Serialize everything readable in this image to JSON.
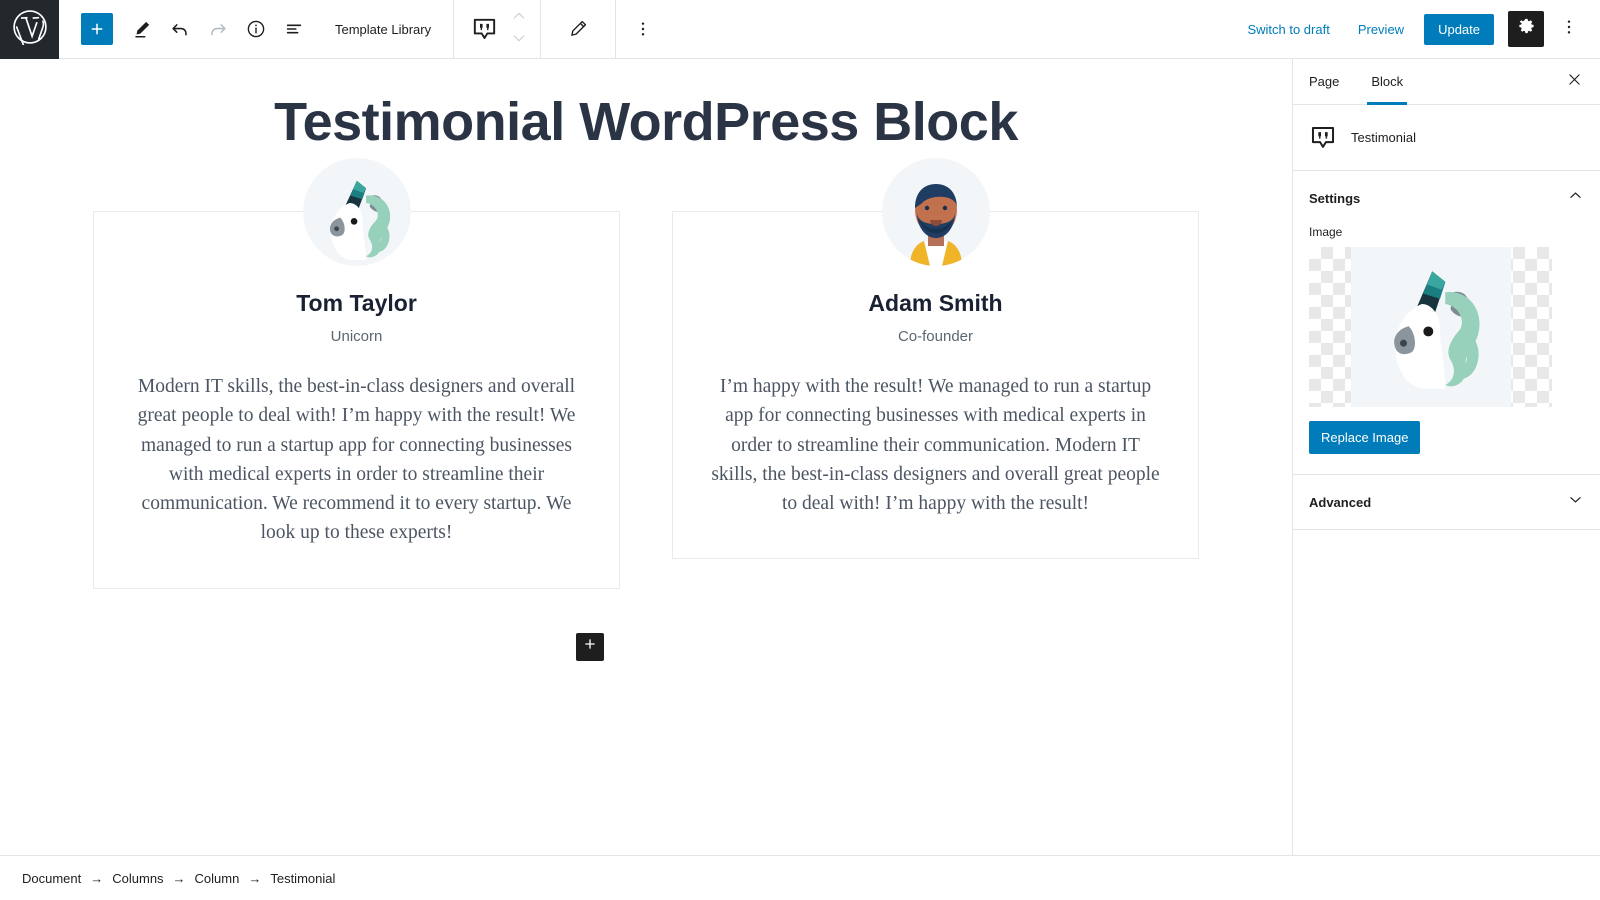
{
  "toolbar": {
    "logo_icon": "wordpress-logo-icon",
    "add_block_label": "+",
    "add_block_icon": "plus-icon",
    "edit_icon": "pencil-edit-icon",
    "undo_icon": "undo-arrow-icon",
    "redo_icon": "redo-arrow-icon",
    "info_icon": "info-circle-icon",
    "list_view_icon": "list-view-icon",
    "template_library_label": "Template Library",
    "block_type_icon": "quote-block-icon",
    "move_up_icon": "chevron-up-icon",
    "move_down_icon": "chevron-down-icon",
    "block_edit_icon": "pencil-icon",
    "block_options_icon": "more-vertical-icon",
    "switch_to_draft_label": "Switch to draft",
    "preview_label": "Preview",
    "update_label": "Update",
    "settings_gear_icon": "gear-icon",
    "more_options_icon": "more-vertical-icon"
  },
  "canvas": {
    "page_title": "Testimonial WordPress Block",
    "appender_icon": "plus-icon",
    "testimonials": [
      {
        "avatar_icon": "unicorn-avatar-icon",
        "name": "Tom Taylor",
        "role": "Unicorn",
        "text": "Modern IT skills, the best-in-class designers and overall great people to deal with! I’m happy with the result! We managed to run a startup app for connecting businesses with medical experts in order to streamline their communication. We recommend it to every startup. We look up to these experts!"
      },
      {
        "avatar_icon": "bearded-man-avatar-icon",
        "name": "Adam Smith",
        "role": "Co-founder",
        "text": "I’m happy with the result! We managed to run a startup app for connecting businesses with medical experts in order to streamline their communication. Modern IT skills, the best-in-class designers and overall great people to deal with! I’m happy with the result!"
      }
    ]
  },
  "sidebar": {
    "tabs": [
      {
        "label": "Page",
        "active": false
      },
      {
        "label": "Block",
        "active": true
      }
    ],
    "close_icon": "close-icon",
    "block_icon": "quote-block-icon",
    "block_name": "Testimonial",
    "panels": [
      {
        "title": "Settings",
        "expanded": true,
        "toggle_icon": "chevron-up-icon",
        "field_label": "Image",
        "image_icon": "unicorn-image-icon",
        "replace_button_label": "Replace Image"
      },
      {
        "title": "Advanced",
        "expanded": false,
        "toggle_icon": "chevron-down-icon"
      }
    ]
  },
  "breadcrumb": {
    "separator": "→",
    "items": [
      "Document",
      "Columns",
      "Column",
      "Testimonial"
    ]
  },
  "colors": {
    "accent": "#007cba",
    "dark": "#1e1e1e",
    "logo_bg": "#23282d",
    "border": "#e2e4e7",
    "card_border": "#e8eaed",
    "title": "#2b3445",
    "body_text": "#4c5562",
    "role_text": "#5c6670"
  }
}
